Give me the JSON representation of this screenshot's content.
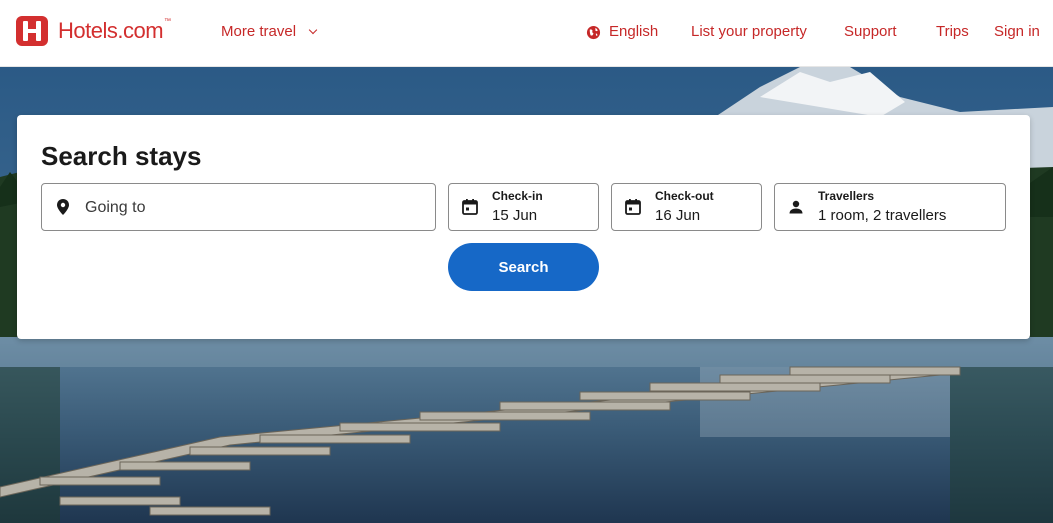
{
  "header": {
    "brand": "Hotels.com",
    "brand_mark": "™",
    "nav": {
      "more_travel": "More travel",
      "language": "English",
      "list_property": "List your property",
      "support": "Support",
      "trips": "Trips",
      "sign_in": "Sign in"
    }
  },
  "search": {
    "title": "Search stays",
    "destination": {
      "placeholder": "Going to",
      "icon": "map-pin-icon"
    },
    "check_in": {
      "label": "Check-in",
      "value": "15 Jun",
      "icon": "calendar-icon"
    },
    "check_out": {
      "label": "Check-out",
      "value": "16 Jun",
      "icon": "calendar-icon"
    },
    "travellers": {
      "label": "Travellers",
      "value": "1 room, 2 travellers",
      "icon": "person-icon"
    },
    "button_label": "Search"
  },
  "colors": {
    "brand_red": "#d32f2f",
    "nav_red": "#c62828",
    "search_blue": "#1668c7"
  }
}
